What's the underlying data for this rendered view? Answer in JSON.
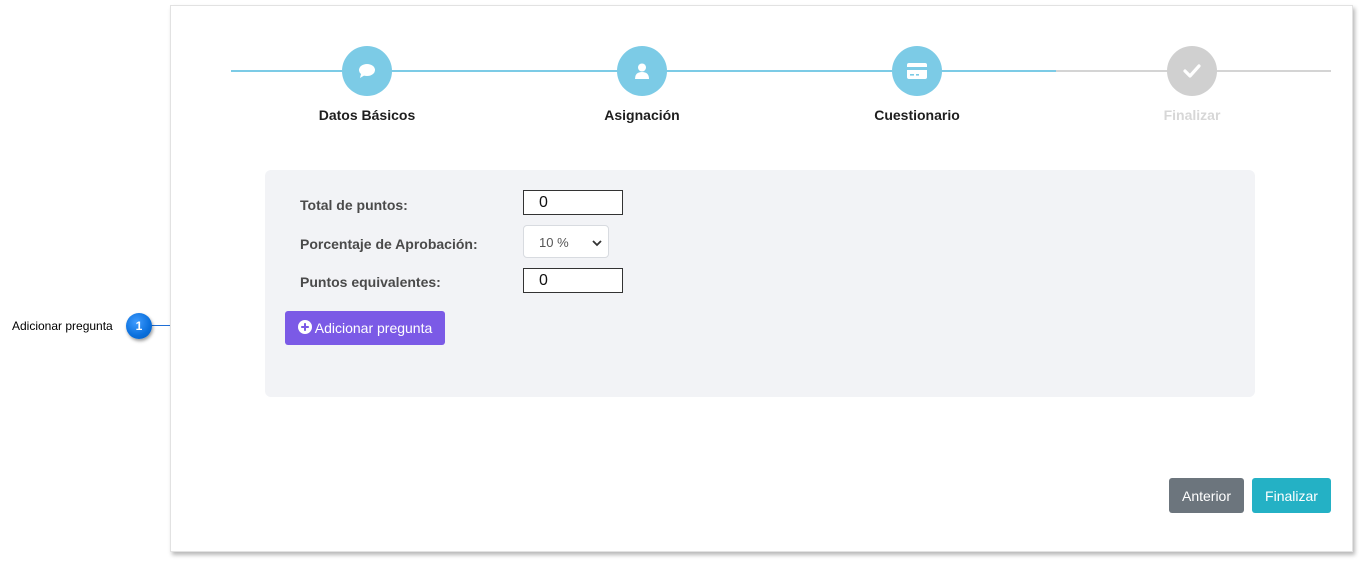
{
  "wizard": {
    "steps": [
      {
        "label": "Datos Básicos",
        "icon": "comment-icon",
        "state": "active"
      },
      {
        "label": "Asignación",
        "icon": "user-icon",
        "state": "active"
      },
      {
        "label": "Cuestionario",
        "icon": "credit-card-icon",
        "state": "active"
      },
      {
        "label": "Finalizar",
        "icon": "check-icon",
        "state": "inactive"
      }
    ],
    "active_color": "#7ccbe6",
    "inactive_color": "#d0d0d0"
  },
  "form": {
    "total_points_label": "Total de puntos:",
    "total_points_value": "0",
    "approval_label": "Porcentaje de Aprobación:",
    "approval_selected": "10 %",
    "equivalent_label": "Puntos equivalentes:",
    "equivalent_value": "0",
    "add_question_label": "Adicionar pregunta",
    "add_question_color": "#7b5ae6"
  },
  "footer": {
    "prev_label": "Anterior",
    "finish_label": "Finalizar"
  },
  "callout": {
    "number": "1",
    "text": "Adicionar pregunta"
  }
}
